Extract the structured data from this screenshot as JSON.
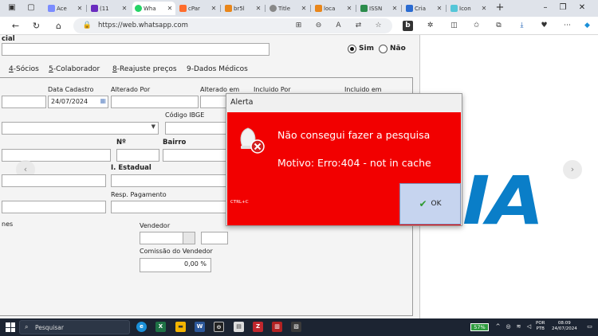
{
  "browser": {
    "tabs": [
      {
        "label": "Ace",
        "fav_color": "#7b8cff"
      },
      {
        "label": "(11",
        "fav_color": "#6a2cbf"
      },
      {
        "label": "Wha",
        "fav_color": "#25d366",
        "active": true
      },
      {
        "label": "cPar",
        "fav_color": "#ff6c2c"
      },
      {
        "label": "br5l",
        "fav_color": "#e9861a"
      },
      {
        "label": "Title",
        "fav_color": "#888888"
      },
      {
        "label": "loca",
        "fav_color": "#e9861a"
      },
      {
        "label": "ISSN",
        "fav_color": "#2c8c4c"
      },
      {
        "label": "Cria",
        "fav_color": "#2a6bd1"
      },
      {
        "label": "Ícon",
        "fav_color": "#55c6d8"
      }
    ],
    "url": "https://web.whatsapp.com",
    "window_controls": {
      "minimize": "–",
      "maximize": "❐",
      "close": "✕"
    }
  },
  "erp": {
    "top_label": "cial",
    "radio_yes": "Sim",
    "radio_no": "Não",
    "tabs": [
      {
        "key": "4",
        "rest": "-Sócios"
      },
      {
        "key": "5",
        "rest": "-Colaborador"
      },
      {
        "key": "8",
        "rest": "-Reajuste preços"
      },
      {
        "key": "9",
        "rest": "-Dados Médicos"
      }
    ],
    "labels": {
      "data_cadastro": "Data Cadastro",
      "alterado_por": "Alterado Por",
      "alterado_em": "Alterado em",
      "incluido_por": "Incluido Por",
      "incluido_em": "Incluido em",
      "codigo_ibge": "Código IBGE",
      "numero": "Nº",
      "bairro": "Bairro",
      "estadual": "I. Estadual",
      "resp_pagamento": "Resp. Pagamento",
      "nes": "nes",
      "vendedor": "Vendedor",
      "comissao_vendedor": "Comissão do Vendedor"
    },
    "values": {
      "data_cadastro": "24/07/2024",
      "comissao_vendedor": "0,00 %"
    }
  },
  "alert": {
    "title": "Alerta",
    "message": "Não consegui fazer a pesquisa",
    "reason": "Motivo: Erro:404 - not in cache",
    "shortcut": "CTRL+C",
    "ok_label": "OK",
    "bg_color": "#f20000"
  },
  "logo": {
    "text": "IA",
    "color": "#0a7ec8"
  },
  "taskbar": {
    "search_placeholder": "Pesquisar",
    "battery": "57%",
    "lang_top": "POR",
    "lang_bottom": "PTB",
    "time": "08:09",
    "date": "24/07/2024"
  }
}
